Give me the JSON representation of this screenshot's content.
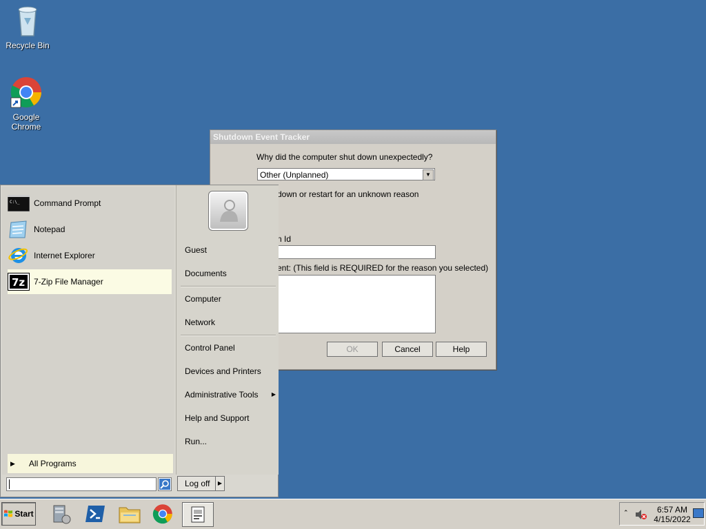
{
  "desktop": {
    "icons": [
      {
        "label": "Recycle Bin",
        "icon": "recycle-bin-icon"
      },
      {
        "label": "Google Chrome",
        "icon": "chrome-icon"
      }
    ]
  },
  "dialog": {
    "title": "Shutdown Event Tracker",
    "question": "Why did the computer shut down unexpectedly?",
    "reason_selected": "Other (Unplanned)",
    "reason_description": "down or restart for an unknown reason",
    "problem_id_label": "n Id",
    "problem_id_value": "",
    "comment_label": "ent: (This field is REQUIRED for the reason you selected)",
    "comment_value": "",
    "buttons": {
      "ok": "OK",
      "cancel": "Cancel",
      "help": "Help"
    }
  },
  "start_menu": {
    "pinned": [
      {
        "label": "Command Prompt",
        "icon": "command-prompt-icon"
      },
      {
        "label": "Notepad",
        "icon": "notepad-icon"
      },
      {
        "label": "Internet Explorer",
        "icon": "internet-explorer-icon"
      },
      {
        "label": "7-Zip File Manager",
        "icon": "7zip-icon"
      }
    ],
    "all_programs": "All Programs",
    "search_value": "",
    "right": {
      "user": "Guest",
      "documents": "Documents",
      "computer": "Computer",
      "network": "Network",
      "control_panel": "Control Panel",
      "devices": "Devices and Printers",
      "admin_tools": "Administrative Tools",
      "help": "Help and Support",
      "run": "Run..."
    },
    "logoff": "Log off"
  },
  "taskbar": {
    "start": "Start",
    "apps": [
      "server-manager-icon",
      "powershell-icon",
      "explorer-icon",
      "chrome-icon",
      "shutdown-tracker-icon"
    ],
    "clock_time": "6:57 AM",
    "clock_date": "4/15/2022"
  },
  "colors": {
    "desktop": "#3b6ea5",
    "highlight": "#fbfbe4"
  }
}
